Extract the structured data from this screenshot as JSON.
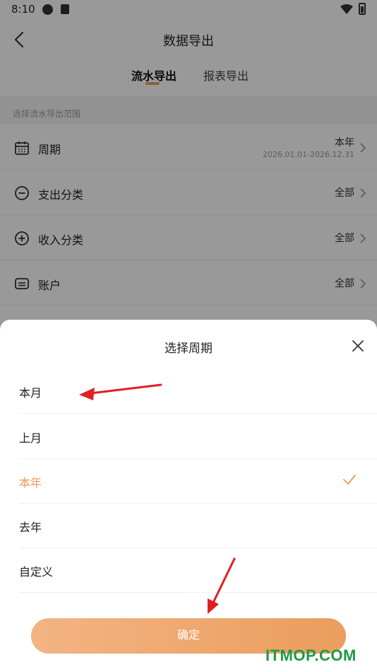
{
  "status_bar": {
    "time": "8:10"
  },
  "header": {
    "title": "数据导出"
  },
  "tabs": [
    {
      "label": "流水导出"
    },
    {
      "label": "报表导出"
    }
  ],
  "section": {
    "hint": "选择流水导出范围"
  },
  "rows": [
    {
      "label": "周期",
      "value": "本年",
      "sub": "2026.01.01-2026.12.31",
      "icon": "calendar-icon"
    },
    {
      "label": "支出分类",
      "value": "全部",
      "icon": "minus-circle-icon"
    },
    {
      "label": "收入分类",
      "value": "全部",
      "icon": "plus-circle-icon"
    },
    {
      "label": "账户",
      "value": "全部",
      "icon": "card-icon"
    }
  ],
  "sheet": {
    "title": "选择周期",
    "options": [
      {
        "label": "本月",
        "selected": false
      },
      {
        "label": "上月",
        "selected": false
      },
      {
        "label": "本年",
        "selected": true
      },
      {
        "label": "去年",
        "selected": false
      },
      {
        "label": "自定义",
        "selected": false
      }
    ],
    "confirm_label": "确定"
  },
  "watermark": "ITMOP.COM",
  "colors": {
    "accent": "#e89a55",
    "annotation_arrow": "#e02020",
    "watermark": "#1a9b46"
  }
}
